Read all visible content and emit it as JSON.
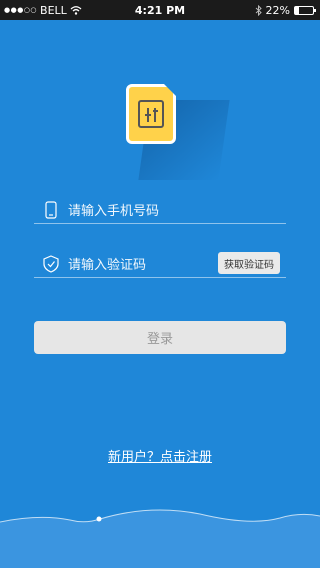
{
  "status_bar": {
    "signal": "●●●○○",
    "carrier": "BELL",
    "time": "4:21 PM",
    "battery_text": "22%",
    "battery_level": 0.22
  },
  "app": {
    "logo_icon": "app-logo-icon",
    "colors": {
      "background": "#1f87d8",
      "logo": "#ffd24a",
      "button": "#e6e6e6"
    }
  },
  "form": {
    "phone_placeholder": "请输入手机号码",
    "code_placeholder": "请输入验证码",
    "get_code_label": "获取验证码",
    "login_label": "登录"
  },
  "footer": {
    "register_link": "新用户？点击注册"
  }
}
